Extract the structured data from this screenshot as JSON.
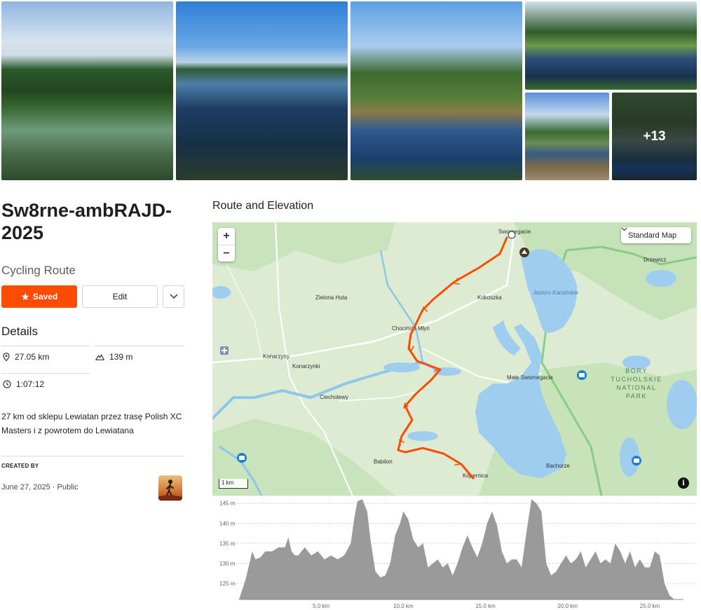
{
  "gallery": {
    "more_count": "+13"
  },
  "route": {
    "title": "Sw8rne-ambRAJD-2025",
    "type": "Cycling Route",
    "saved_label": "Saved",
    "edit_label": "Edit"
  },
  "details": {
    "heading": "Details",
    "distance": "27.05 km",
    "elevation_gain": "139 m",
    "moving_time": "1:07:12",
    "description": "27 km od sklepu Lewiatan przez trasę Polish XC Masters i z powrotem do Lewiatana",
    "created_by_label": "CREATED BY",
    "date": "June 27, 2025",
    "visibility": "Public"
  },
  "map": {
    "heading": "Route and Elevation",
    "map_style": "Standard Map",
    "scale_label": "1 km",
    "zoom_in": "+",
    "zoom_out": "−",
    "places": {
      "swornegacie": "Swornegacie",
      "drzewicz": "Drzewicz",
      "zielona_huta": "Zielona Huta",
      "kokoszka": "Kokoszka",
      "jezioro": "Jezioro Karsińskie",
      "chocinski": "Chociński Młyn",
      "konarzyny": "Konarzyny",
      "konarzynki": "Konarzynki",
      "male_swornegacie": "Małe Swornegacie",
      "ciecholewy": "Ciecholewy",
      "bory": "BORY TUCHOLSKIE NATIONAL PARK",
      "babilon": "Babilon",
      "bachorze": "Bachorze",
      "kopernica": "Kopernica"
    }
  },
  "chart_data": {
    "type": "area",
    "title": "",
    "xlabel": "",
    "ylabel": "",
    "x_ticks": [
      "5.0 km",
      "10.0 km",
      "15.0 km",
      "20.0 km",
      "25.0 km"
    ],
    "y_ticks": [
      "125 m",
      "130 m",
      "135 m",
      "140 m",
      "145 m"
    ],
    "xlim": [
      0,
      27.05
    ],
    "ylim": [
      121,
      146
    ],
    "x": [
      0,
      0.4,
      0.8,
      1.0,
      1.3,
      1.6,
      2.0,
      2.4,
      2.8,
      3.0,
      3.2,
      3.4,
      3.6,
      4.0,
      4.4,
      4.8,
      5.2,
      5.6,
      6.0,
      6.4,
      6.8,
      7.0,
      7.2,
      7.5,
      7.8,
      8.0,
      8.3,
      8.6,
      8.9,
      9.2,
      9.5,
      9.8,
      10.0,
      10.3,
      10.6,
      10.9,
      11.2,
      11.5,
      11.8,
      12.1,
      12.4,
      12.7,
      13.0,
      13.3,
      13.6,
      13.9,
      14.2,
      14.5,
      14.8,
      15.1,
      15.4,
      15.7,
      16.0,
      16.3,
      16.6,
      16.9,
      17.2,
      17.5,
      17.8,
      18.1,
      18.4,
      18.7,
      19.0,
      19.3,
      19.6,
      19.9,
      20.2,
      20.5,
      20.8,
      21.1,
      21.4,
      21.7,
      22.0,
      22.3,
      22.6,
      22.9,
      23.2,
      23.5,
      23.8,
      24.1,
      24.4,
      24.7,
      25.0,
      25.3,
      25.6,
      25.9,
      26.2,
      26.5,
      26.8,
      27.05
    ],
    "values": [
      121,
      126,
      133,
      131,
      131.5,
      133,
      133,
      134,
      134,
      136.5,
      133,
      132,
      132,
      134,
      132,
      133,
      131,
      132,
      131,
      132,
      135,
      141,
      145.5,
      146,
      143,
      136,
      128,
      126.5,
      127,
      130,
      137,
      140,
      143,
      141,
      136,
      134,
      135,
      129,
      130,
      131,
      129,
      130,
      127,
      130,
      134,
      137,
      134,
      131.5,
      135,
      140,
      143,
      139.5,
      133,
      130,
      131,
      131,
      129,
      138,
      146,
      145,
      143,
      130,
      127,
      128,
      130,
      132,
      130,
      131,
      133,
      129,
      131,
      133,
      130,
      131,
      130,
      135,
      133,
      130,
      133,
      129,
      131,
      129,
      129,
      133,
      132,
      125,
      122,
      121,
      121,
      121
    ]
  }
}
